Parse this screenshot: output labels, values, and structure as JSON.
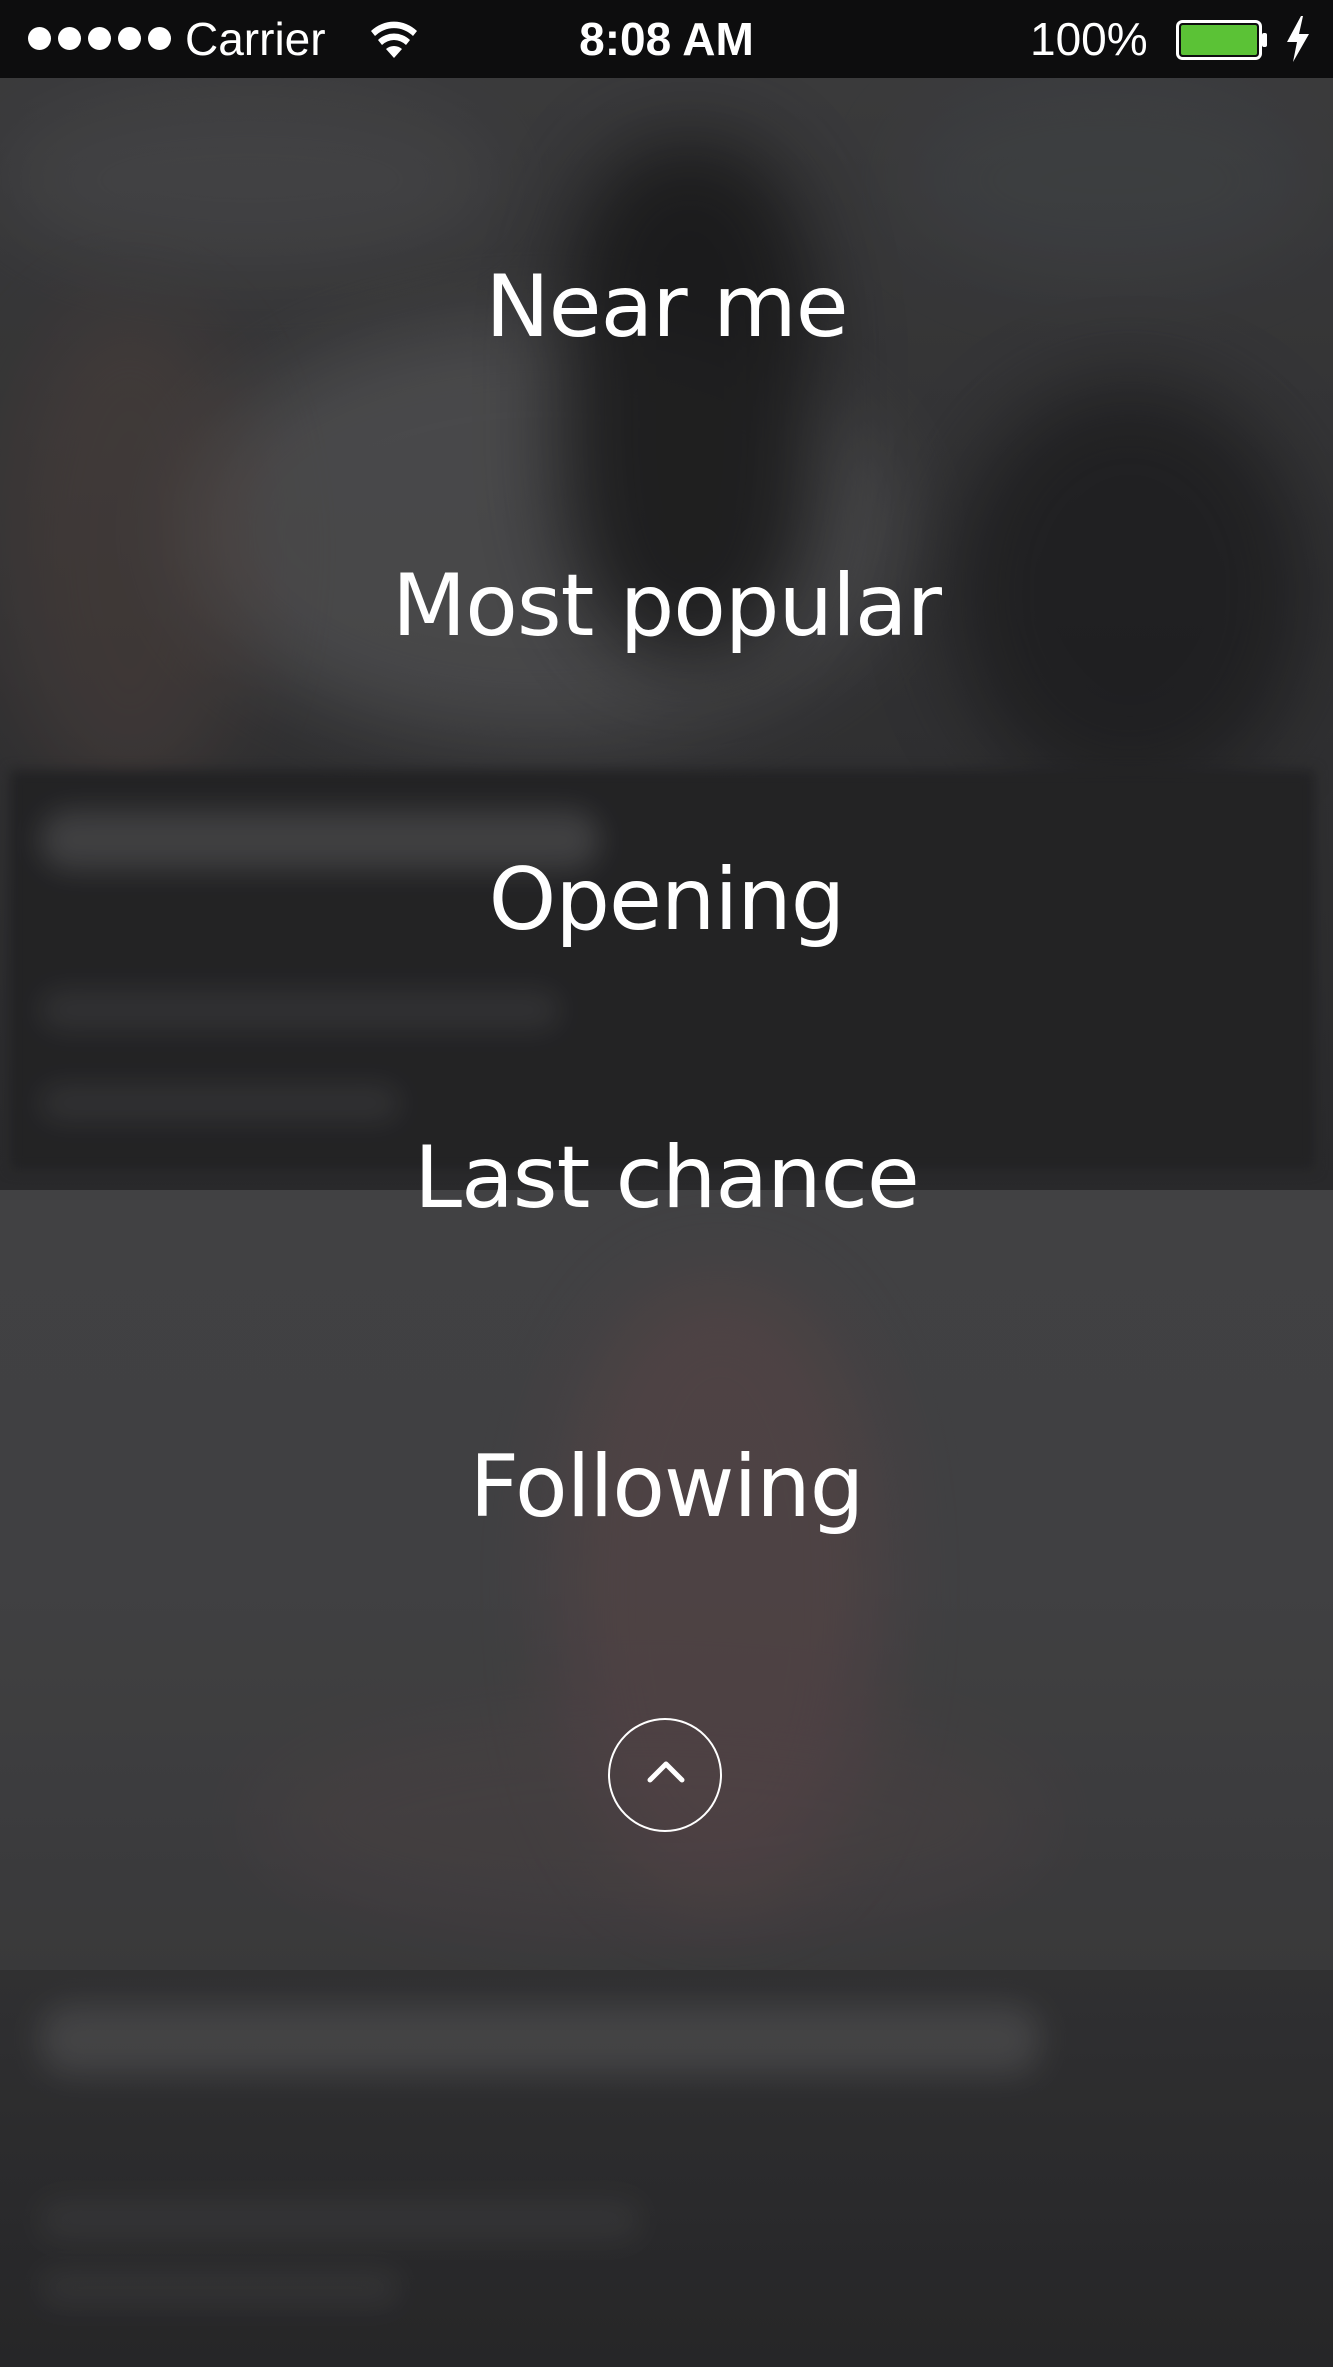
{
  "status_bar": {
    "carrier": "Carrier",
    "time": "8:08 AM",
    "battery_percent": "100%",
    "battery_color": "#5bc236",
    "signal_bars": 5,
    "icons": [
      "signal-dots-icon",
      "wifi-icon",
      "battery-icon",
      "charging-bolt-icon"
    ]
  },
  "menu": {
    "items": [
      {
        "label": "Near me"
      },
      {
        "label": "Most popular"
      },
      {
        "label": "Opening"
      },
      {
        "label": "Last chance"
      },
      {
        "label": "Following"
      }
    ],
    "collapse_icon": "chevron-up-icon"
  }
}
